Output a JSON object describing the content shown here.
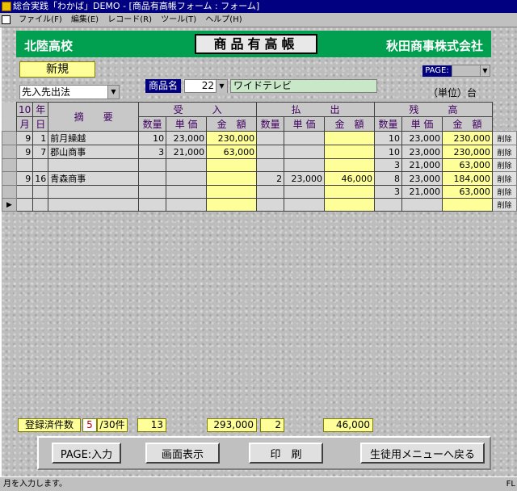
{
  "window": {
    "title": "総合実践「わかば」DEMO - [商品有高帳フォーム : フォーム]"
  },
  "menu": [
    "ファイル(F)",
    "編集(E)",
    "レコード(R)",
    "ツール(T)",
    "ヘルプ(H)"
  ],
  "header": {
    "school": "北陸高校",
    "doc_title": "商品有高帳",
    "company": "秋田商事株式会社"
  },
  "mode": "新規",
  "page_label": "PAGE:",
  "page_value": "",
  "method": "先入先出法",
  "item": {
    "label": "商品名",
    "code": "22",
    "name": "ワイドテレビ"
  },
  "unit": "（単位）台",
  "table": {
    "year_header": "年",
    "month_value": "10",
    "month_header": "月",
    "day_header": "日",
    "desc_header": "摘　　要",
    "receipt_header": "受　　　入",
    "payment_header": "払　　　出",
    "balance_header": "残　　　高",
    "qty_header": "数量",
    "price_header": "単 価",
    "amount_header": "金　額",
    "delete_label": "削除",
    "rows": [
      {
        "m": "9",
        "d": "1",
        "desc": "前月繰越",
        "rq": "10",
        "rp": "23,000",
        "ra": "230,000",
        "pq": "",
        "pp": "",
        "pa": "",
        "bq": "10",
        "bp": "23,000",
        "ba": "230,000",
        "marker": ""
      },
      {
        "m": "9",
        "d": "7",
        "desc": "郡山商事",
        "rq": "3",
        "rp": "21,000",
        "ra": "63,000",
        "pq": "",
        "pp": "",
        "pa": "",
        "bq": "10",
        "bp": "23,000",
        "ba": "230,000",
        "marker": ""
      },
      {
        "m": "",
        "d": "",
        "desc": "",
        "rq": "",
        "rp": "",
        "ra": "",
        "pq": "",
        "pp": "",
        "pa": "",
        "bq": "3",
        "bp": "21,000",
        "ba": "63,000",
        "marker": ""
      },
      {
        "m": "9",
        "d": "16",
        "desc": "青森商事",
        "rq": "",
        "rp": "",
        "ra": "",
        "pq": "2",
        "pp": "23,000",
        "pa": "46,000",
        "bq": "8",
        "bp": "23,000",
        "ba": "184,000",
        "marker": ""
      },
      {
        "m": "",
        "d": "",
        "desc": "",
        "rq": "",
        "rp": "",
        "ra": "",
        "pq": "",
        "pp": "",
        "pa": "",
        "bq": "3",
        "bp": "21,000",
        "ba": "63,000",
        "marker": ""
      },
      {
        "m": "",
        "d": "",
        "desc": "",
        "rq": "",
        "rp": "",
        "ra": "",
        "pq": "",
        "pp": "",
        "pa": "",
        "bq": "",
        "bp": "",
        "ba": "",
        "marker": "▶"
      }
    ]
  },
  "summary": {
    "label": "登録済件数",
    "count": "5",
    "total_suffix": "/30件",
    "receipt_qty": "13",
    "receipt_amount": "293,000",
    "payment_qty": "2",
    "payment_amount": "46,000"
  },
  "buttons": {
    "page_input": "PAGE:入力",
    "screen_display": "画面表示",
    "print": "印　刷",
    "back_menu": "生徒用メニューへ戻る"
  },
  "status": {
    "message": "月を入力します。",
    "indicator": "FL"
  }
}
